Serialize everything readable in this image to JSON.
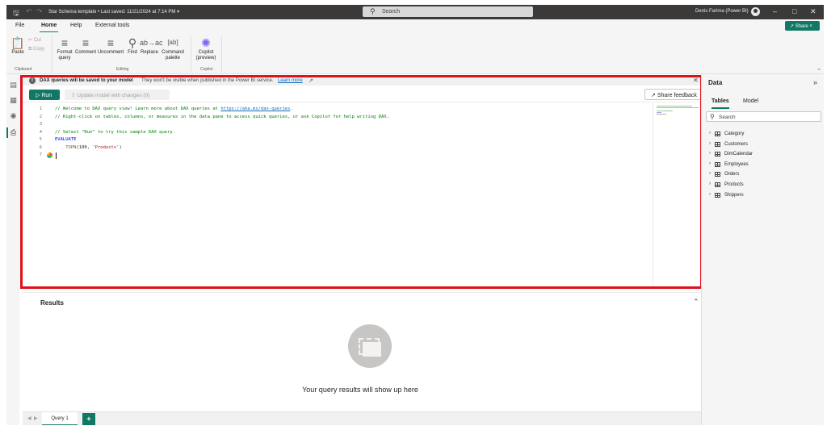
{
  "titlebar": {
    "doc_title": "Star Schema template • Last saved: 11/21/2024 at 7:14 PM ▾",
    "search_placeholder": "Search",
    "user": "Denis Farima (Power BI)",
    "icons": [
      "save-icon",
      "undo-icon",
      "redo-icon",
      "search-icon",
      "avatar",
      "minimize-icon",
      "maximize-icon",
      "close-icon"
    ]
  },
  "menu": {
    "items": [
      "File",
      "Home",
      "Help",
      "External tools"
    ],
    "active": "Home",
    "share_label": "Share"
  },
  "ribbon": {
    "paste": "Paste",
    "cut": "Cut",
    "copy": "Copy",
    "clipboard_group": "Clipboard",
    "format_query": "Format query",
    "comment": "Comment",
    "uncomment": "Uncomment",
    "find": "Find",
    "replace": "Replace",
    "command_palette": "Command palette",
    "editing_group": "Editing",
    "copilot": "Copilot (preview)",
    "copilot_group": "Copilot"
  },
  "infobar": {
    "bold_text": "DAX queries will be saved to your model",
    "text": "They won't be visible when published in the Power BI service.",
    "link": "Learn more"
  },
  "toolbar": {
    "run": "Run",
    "update": "Update model with changes (0)",
    "feedback": "Share feedback"
  },
  "editor": {
    "lines": [
      {
        "n": "1",
        "parts": [
          [
            "c-comment",
            "// Welcome to DAX query view! Learn more about DAX queries at "
          ],
          [
            "c-link",
            "https://aka.ms/dax-queries"
          ],
          [
            "c-comment",
            "."
          ]
        ]
      },
      {
        "n": "2",
        "parts": [
          [
            "c-comment",
            "// Right-click on tables, columns, or measures in the data pane to access quick queries, or ask Copilot for help writing DAX."
          ]
        ]
      },
      {
        "n": "3",
        "parts": []
      },
      {
        "n": "4",
        "parts": [
          [
            "c-comment",
            "// Select \"Run\" to try this sample DAX query."
          ]
        ]
      },
      {
        "n": "5",
        "parts": [
          [
            "c-kw",
            "EVALUATE"
          ]
        ]
      },
      {
        "n": "6",
        "parts": [
          [
            "c-fn",
            "    TOPN"
          ],
          [
            "",
            "(100, "
          ],
          [
            "c-str",
            "'Products'"
          ],
          [
            "",
            ")"
          ]
        ]
      },
      {
        "n": "7",
        "parts": []
      }
    ]
  },
  "results": {
    "title": "Results",
    "empty_text": "Your query results will show up here"
  },
  "queries": {
    "tab": "Query 1",
    "add": "+"
  },
  "datapane": {
    "title": "Data",
    "tabs": [
      "Tables",
      "Model"
    ],
    "active_tab": "Tables",
    "search_placeholder": "Search",
    "tables": [
      "Category",
      "Customers",
      "DimCalendar",
      "Employees",
      "Orders",
      "Products",
      "Shippers"
    ]
  },
  "colors": {
    "accent": "#117865",
    "highlight": "#e0101a"
  }
}
